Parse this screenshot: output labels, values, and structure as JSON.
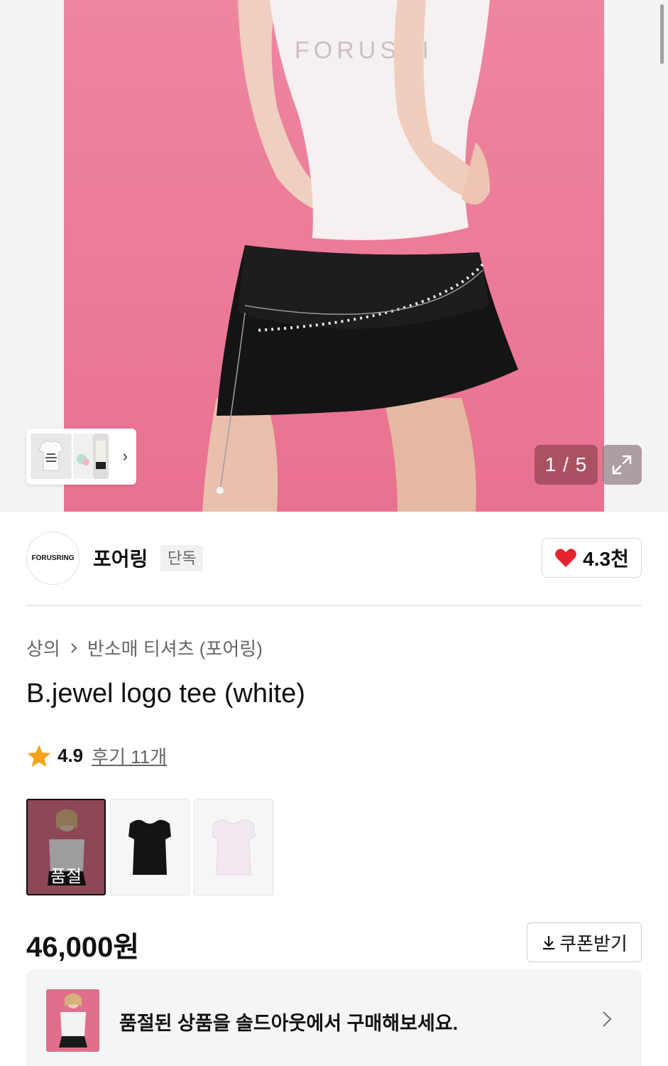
{
  "gallery": {
    "counter": "1 / 5",
    "current_index": 1,
    "total": 5,
    "shirt_print": "FORUSRI"
  },
  "brand": {
    "logo_text": "FORUSRING",
    "name": "포어링",
    "badge": "단독",
    "like_count": "4.3천"
  },
  "breadcrumb": {
    "items": [
      "상의",
      "반소매 티셔츠 (포어링)"
    ]
  },
  "product": {
    "title": "B.jewel logo tee (white)",
    "rating": "4.9",
    "review_link": "후기 11개",
    "price": "46,000원"
  },
  "options": {
    "soldout_label": "품절"
  },
  "coupon": {
    "label": "쿠폰받기"
  },
  "banner": {
    "text": "품절된 상품을 솔드아웃에서 구매해보세요."
  },
  "colors": {
    "hero_pink": "#ee86a0",
    "heart_red": "#e4242e",
    "star_orange": "#f7a21b"
  }
}
